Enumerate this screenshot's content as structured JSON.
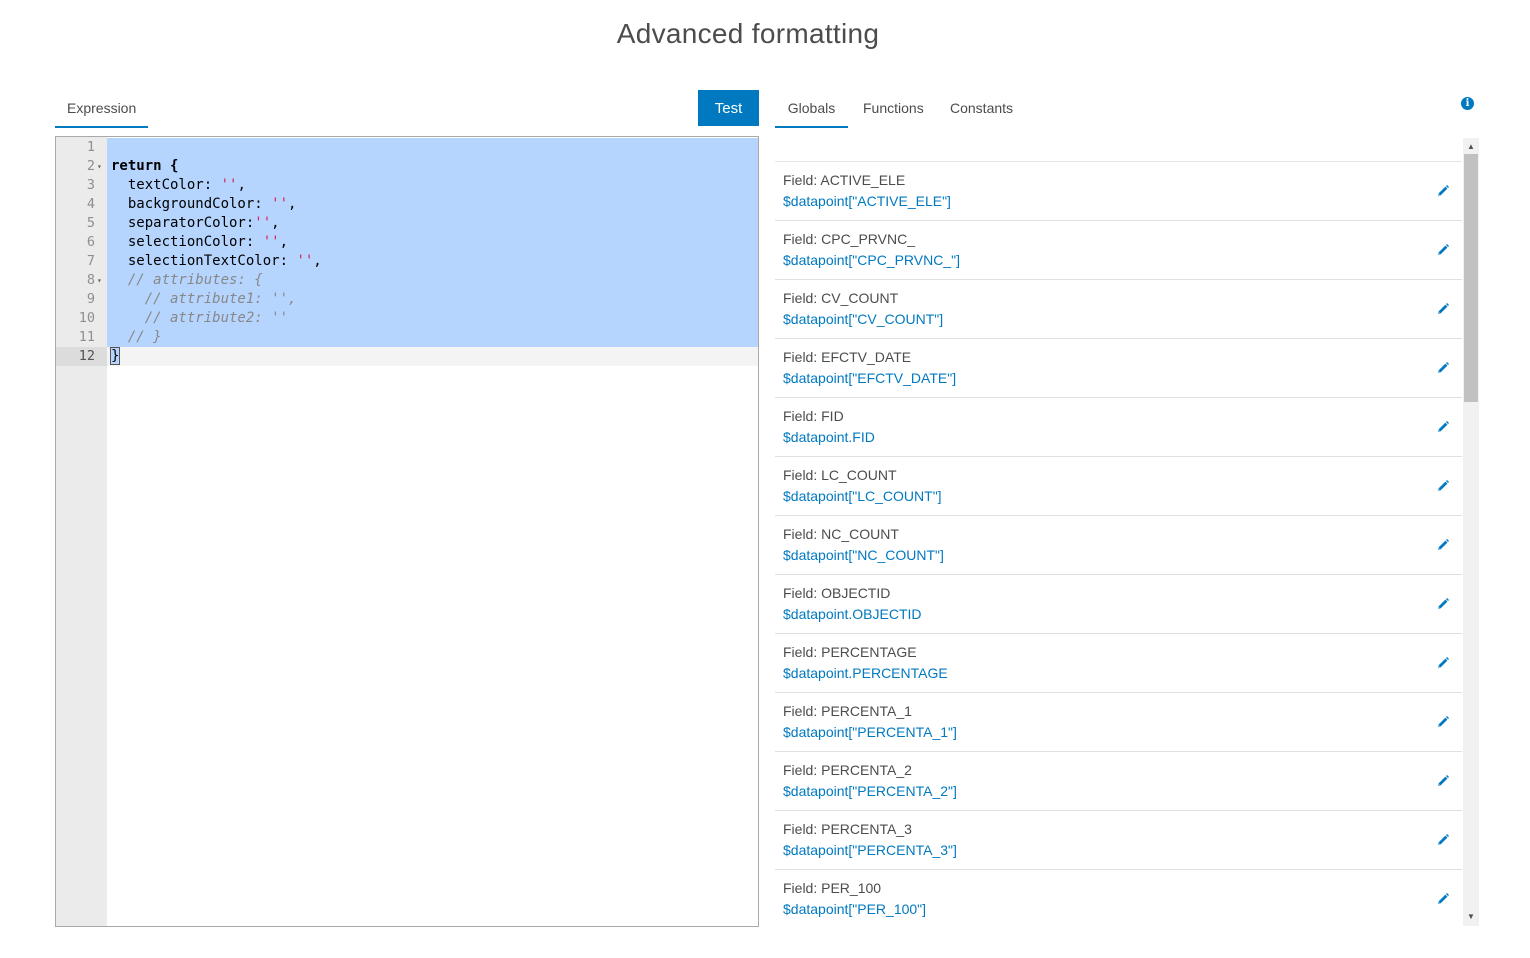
{
  "page": {
    "title": "Advanced formatting"
  },
  "left": {
    "tabs": [
      {
        "label": "Expression",
        "active": true
      }
    ],
    "test_label": "Test"
  },
  "editor": {
    "lines": [
      {
        "n": "1",
        "fold": "",
        "selected": true,
        "current": false,
        "tokens": []
      },
      {
        "n": "2",
        "fold": "▾",
        "selected": true,
        "current": false,
        "tokens": [
          {
            "t": "return",
            "c": "kw"
          },
          {
            "t": " {",
            "c": "kw"
          }
        ]
      },
      {
        "n": "3",
        "fold": "",
        "selected": true,
        "current": false,
        "tokens": [
          {
            "t": "  textColor: ",
            "c": ""
          },
          {
            "t": "''",
            "c": "str"
          },
          {
            "t": ",",
            "c": ""
          }
        ]
      },
      {
        "n": "4",
        "fold": "",
        "selected": true,
        "current": false,
        "tokens": [
          {
            "t": "  backgroundColor: ",
            "c": ""
          },
          {
            "t": "''",
            "c": "str"
          },
          {
            "t": ",",
            "c": ""
          }
        ]
      },
      {
        "n": "5",
        "fold": "",
        "selected": true,
        "current": false,
        "tokens": [
          {
            "t": "  separatorColor:",
            "c": ""
          },
          {
            "t": "''",
            "c": "str"
          },
          {
            "t": ",",
            "c": ""
          }
        ]
      },
      {
        "n": "6",
        "fold": "",
        "selected": true,
        "current": false,
        "tokens": [
          {
            "t": "  selectionColor: ",
            "c": ""
          },
          {
            "t": "''",
            "c": "str"
          },
          {
            "t": ",",
            "c": ""
          }
        ]
      },
      {
        "n": "7",
        "fold": "",
        "selected": true,
        "current": false,
        "tokens": [
          {
            "t": "  selectionTextColor: ",
            "c": ""
          },
          {
            "t": "''",
            "c": "str"
          },
          {
            "t": ",",
            "c": ""
          }
        ]
      },
      {
        "n": "8",
        "fold": "▾",
        "selected": true,
        "current": false,
        "tokens": [
          {
            "t": "  // attributes: {",
            "c": "cm"
          }
        ]
      },
      {
        "n": "9",
        "fold": "",
        "selected": true,
        "current": false,
        "tokens": [
          {
            "t": "    // attribute1: '',",
            "c": "cm"
          }
        ]
      },
      {
        "n": "10",
        "fold": "",
        "selected": true,
        "current": false,
        "tokens": [
          {
            "t": "    // attribute2: ''",
            "c": "cm"
          }
        ]
      },
      {
        "n": "11",
        "fold": "",
        "selected": true,
        "current": false,
        "tokens": [
          {
            "t": "  // }",
            "c": "cm"
          }
        ]
      },
      {
        "n": "12",
        "fold": "",
        "selected": false,
        "current": true,
        "tokens": [
          {
            "t": "}",
            "c": "cursor"
          }
        ]
      }
    ]
  },
  "right": {
    "tabs": [
      {
        "label": "Globals",
        "active": true
      },
      {
        "label": "Functions",
        "active": false
      },
      {
        "label": "Constants",
        "active": false
      }
    ],
    "info_icon": "i"
  },
  "globals": [
    {
      "label": "Field: ACTIVE_ELE",
      "expr": "$datapoint[\"ACTIVE_ELE\"]"
    },
    {
      "label": "Field: CPC_PRVNC_",
      "expr": "$datapoint[\"CPC_PRVNC_\"]"
    },
    {
      "label": "Field: CV_COUNT",
      "expr": "$datapoint[\"CV_COUNT\"]"
    },
    {
      "label": "Field: EFCTV_DATE",
      "expr": "$datapoint[\"EFCTV_DATE\"]"
    },
    {
      "label": "Field: FID",
      "expr": "$datapoint.FID"
    },
    {
      "label": "Field: LC_COUNT",
      "expr": "$datapoint[\"LC_COUNT\"]"
    },
    {
      "label": "Field: NC_COUNT",
      "expr": "$datapoint[\"NC_COUNT\"]"
    },
    {
      "label": "Field: OBJECTID",
      "expr": "$datapoint.OBJECTID"
    },
    {
      "label": "Field: PERCENTAGE",
      "expr": "$datapoint.PERCENTAGE"
    },
    {
      "label": "Field: PERCENTA_1",
      "expr": "$datapoint[\"PERCENTA_1\"]"
    },
    {
      "label": "Field: PERCENTA_2",
      "expr": "$datapoint[\"PERCENTA_2\"]"
    },
    {
      "label": "Field: PERCENTA_3",
      "expr": "$datapoint[\"PERCENTA_3\"]"
    },
    {
      "label": "Field: PER_100",
      "expr": "$datapoint[\"PER_100\"]"
    }
  ],
  "colors": {
    "accent": "#0079c1",
    "selection": "#b5d5ff",
    "string": "#d6204f",
    "comment": "#888888"
  },
  "icons": {
    "edit": "pencil-icon",
    "info": "info-icon",
    "fold": "fold-arrow-icon",
    "scroll_up": "scroll-up-arrow-icon",
    "scroll_down": "scroll-down-arrow-icon"
  },
  "scroll": {
    "position": 0
  }
}
